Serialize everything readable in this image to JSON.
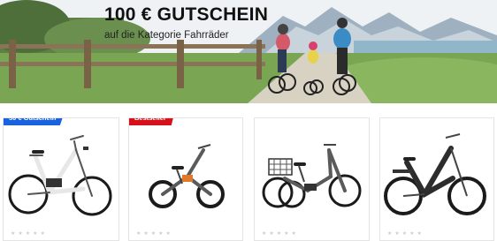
{
  "banner": {
    "title": "100 € GUTSCHEIN",
    "subtitle": "auf die Kategorie Fahrräder"
  },
  "products": [
    {
      "badge": "50 € Gutschein",
      "badge_color": "#1a63e0",
      "bike": "e-bike-step-through-white-icon"
    },
    {
      "badge": "Bestseller",
      "badge_color": "#d5121b",
      "bike": "folding-e-bike-icon"
    },
    {
      "badge": "",
      "bike": "tricycle-e-bike-icon"
    },
    {
      "badge": "",
      "bike": "e-bike-low-entry-black-icon"
    }
  ]
}
